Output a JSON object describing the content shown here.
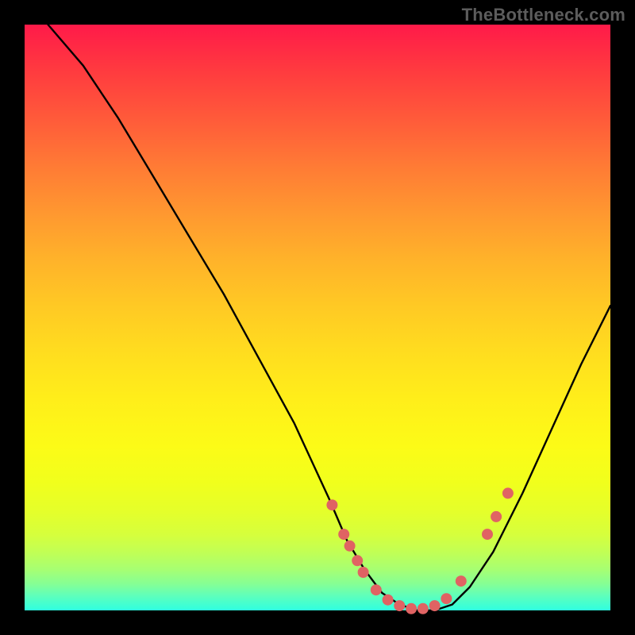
{
  "watermark": "TheBottleneck.com",
  "chart_data": {
    "type": "line",
    "title": "",
    "xlabel": "",
    "ylabel": "",
    "xlim": [
      0,
      100
    ],
    "ylim": [
      0,
      100
    ],
    "series": [
      {
        "name": "curve",
        "x": [
          4,
          10,
          16,
          22,
          28,
          34,
          40,
          46,
          52,
          55,
          58,
          61,
          64,
          67,
          70,
          73,
          76,
          80,
          85,
          90,
          95,
          100
        ],
        "y": [
          100,
          93,
          84,
          74,
          64,
          54,
          43,
          32,
          19,
          12,
          7,
          3,
          1,
          0,
          0,
          1,
          4,
          10,
          20,
          31,
          42,
          52
        ]
      }
    ],
    "markers": {
      "name": "dots",
      "color": "#e06363",
      "radius_pct": 0.95,
      "points": [
        {
          "x": 52.5,
          "y": 18
        },
        {
          "x": 54.5,
          "y": 13
        },
        {
          "x": 55.5,
          "y": 11
        },
        {
          "x": 56.8,
          "y": 8.5
        },
        {
          "x": 57.8,
          "y": 6.5
        },
        {
          "x": 60.0,
          "y": 3.5
        },
        {
          "x": 62.0,
          "y": 1.8
        },
        {
          "x": 64.0,
          "y": 0.8
        },
        {
          "x": 66.0,
          "y": 0.3
        },
        {
          "x": 68.0,
          "y": 0.3
        },
        {
          "x": 70.0,
          "y": 0.8
        },
        {
          "x": 72.0,
          "y": 2.0
        },
        {
          "x": 74.5,
          "y": 5.0
        },
        {
          "x": 79.0,
          "y": 13.0
        },
        {
          "x": 80.5,
          "y": 16.0
        },
        {
          "x": 82.5,
          "y": 20.0
        }
      ]
    }
  }
}
